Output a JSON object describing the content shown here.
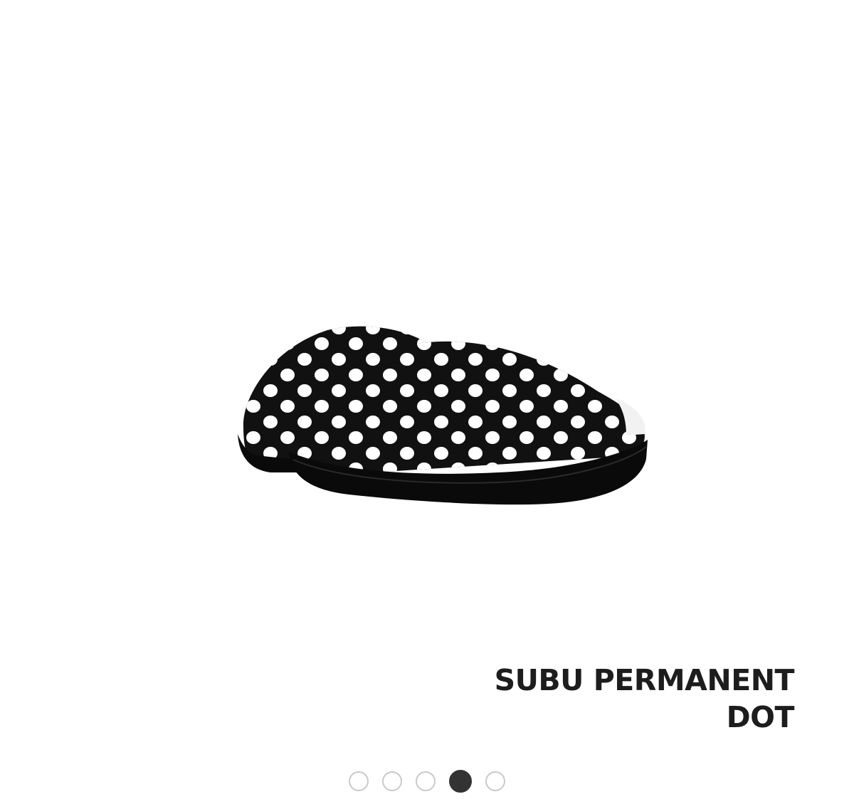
{
  "product": {
    "name_line1": "SUBU PERMANENT",
    "name_line2": "DOT",
    "image_icon": "polka-dot-slipper-image"
  },
  "carousel": {
    "total": 5,
    "active_index": 3
  },
  "colors": {
    "title": "#1d1d1d",
    "dot_active": "#333333",
    "dot_inactive_border": "#c9c9c9"
  }
}
